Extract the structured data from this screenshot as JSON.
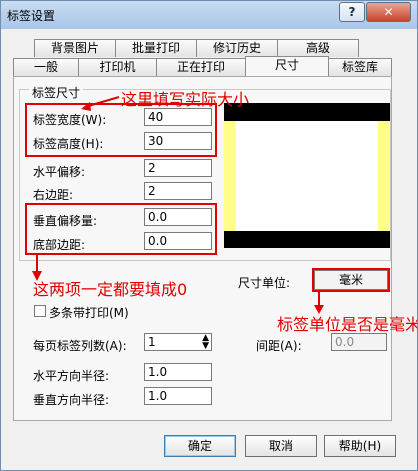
{
  "window": {
    "title": "标签设置"
  },
  "titlebar": {
    "help_label": "?",
    "close_label": "✕"
  },
  "tabs": {
    "row1": [
      "背景图片",
      "批量打印",
      "修订历史",
      "高级"
    ],
    "row2": [
      "一般",
      "打印机",
      "正在打印",
      "尺寸",
      "标签库"
    ],
    "active": "尺寸"
  },
  "group": {
    "label": "标签尺寸"
  },
  "fields": {
    "width_label": "标签宽度(W):",
    "width_value": "40",
    "height_label": "标签高度(H):",
    "height_value": "30",
    "hoffset_label": "水平偏移:",
    "hoffset_value": "2",
    "right_margin_label": "右边距:",
    "right_margin_value": "2",
    "voffset_label": "垂直偏移量:",
    "voffset_value": "0.0",
    "bottom_margin_label": "底部边距:",
    "bottom_margin_value": "0.0",
    "per_page_label": "每页标签列数(A):",
    "per_page_value": "1",
    "spacing_label": "间距(A):",
    "spacing_value": "0.0",
    "h_radius_label": "水平方向半径:",
    "h_radius_value": "1.0",
    "v_radius_label": "垂直方向半径:",
    "v_radius_value": "1.0",
    "multi_print_label": "多条带打印(M)",
    "unit_label": "尺寸单位:",
    "unit_value": "毫米"
  },
  "annotations": {
    "note1": "这里填写实际大小",
    "note2": "这两项一定都要填成0",
    "note3": "标签单位是否是毫米"
  },
  "buttons": {
    "ok": "确定",
    "cancel": "取消",
    "help": "帮助(H)"
  },
  "colors": {
    "annotation_red": "#e00000",
    "preview_yellow": "#ffff88"
  },
  "icons": {
    "stepper": "spinner-icon"
  }
}
